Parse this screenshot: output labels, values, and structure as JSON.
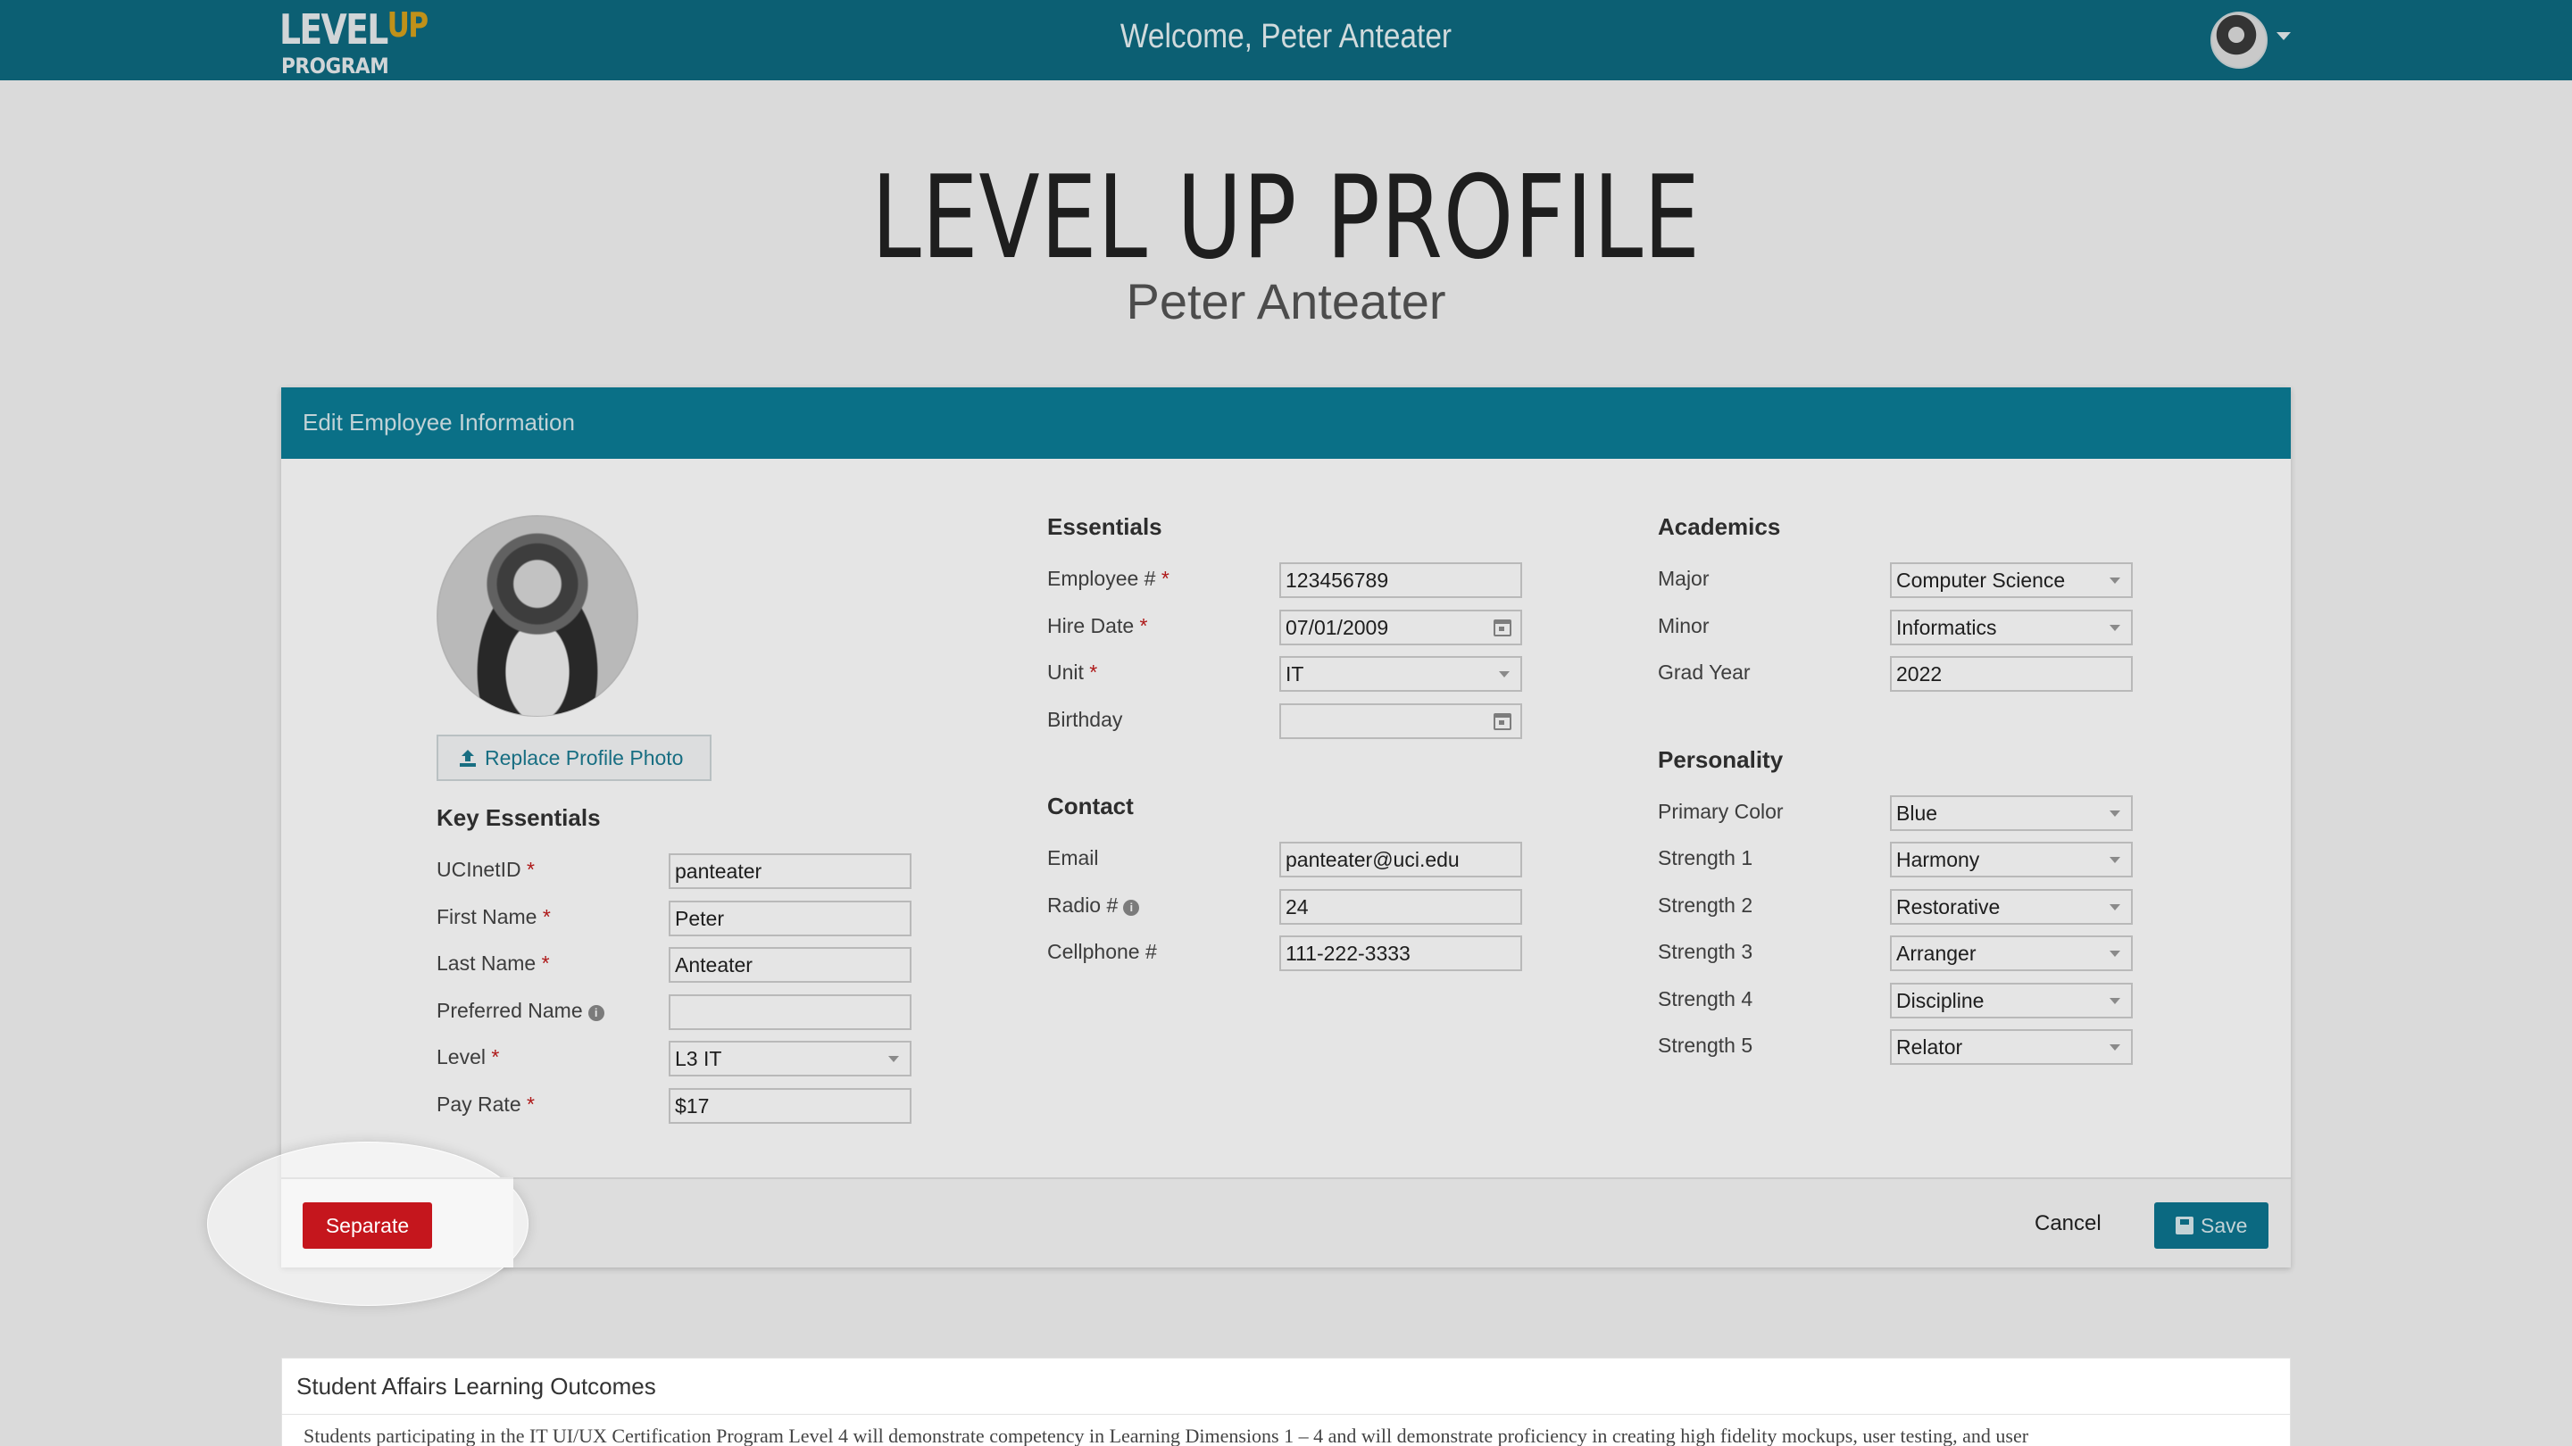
{
  "nav": {
    "logo_top": "LEVEL",
    "logo_up": "UP",
    "logo_bottom": "PROGRAM",
    "welcome": "Welcome, Peter Anteater"
  },
  "page": {
    "title": "LEVEL UP PROFILE",
    "subtitle": "Peter Anteater"
  },
  "panel": {
    "header": "Edit Employee Information",
    "replace_photo": "Replace Profile Photo",
    "key_essentials": {
      "heading": "Key Essentials",
      "fields": [
        {
          "label": "UCInetID",
          "value": "panteater"
        },
        {
          "label": "First Name",
          "value": "Peter"
        },
        {
          "label": "Last Name",
          "value": "Anteater"
        },
        {
          "label": "Preferred Name",
          "value": ""
        },
        {
          "label": "Level",
          "value": "L3 IT"
        },
        {
          "label": "Pay Rate",
          "value": "$17"
        }
      ]
    },
    "essentials": {
      "heading": "Essentials",
      "fields": [
        {
          "label": "Employee #",
          "value": "123456789"
        },
        {
          "label": "Hire Date",
          "value": "07/01/2009"
        },
        {
          "label": "Unit",
          "value": "IT"
        },
        {
          "label": "Birthday",
          "value": ""
        }
      ]
    },
    "contact": {
      "heading": "Contact",
      "fields": [
        {
          "label": "Email",
          "value": "panteater@uci.edu"
        },
        {
          "label": "Radio #",
          "value": "24"
        },
        {
          "label": "Cellphone #",
          "value": "111-222-3333"
        }
      ]
    },
    "academics": {
      "heading": "Academics",
      "fields": [
        {
          "label": "Major",
          "value": "Computer Science"
        },
        {
          "label": "Minor",
          "value": "Informatics"
        },
        {
          "label": "Grad Year",
          "value": "2022"
        }
      ]
    },
    "personality": {
      "heading": "Personality",
      "fields": [
        {
          "label": "Primary Color",
          "value": "Blue"
        },
        {
          "label": "Strength 1",
          "value": "Harmony"
        },
        {
          "label": "Strength 2",
          "value": "Restorative"
        },
        {
          "label": "Strength 3",
          "value": "Arranger"
        },
        {
          "label": "Strength 4",
          "value": "Discipline"
        },
        {
          "label": "Strength 5",
          "value": "Relator"
        }
      ]
    },
    "required_mark": "*",
    "info_mark": "i",
    "footer": {
      "separate": "Separate",
      "cancel": "Cancel",
      "save": "Save"
    }
  },
  "outcomes": {
    "title": "Student Affairs Learning Outcomes",
    "text": "Students participating in the IT UI/UX Certification Program Level 4 will demonstrate competency in Learning Dimensions 1 – 4 and will demonstrate proficiency in creating high fidelity mockups, user testing, and user"
  },
  "colors": {
    "brand_teal": "#0c7d97",
    "nav_teal": "#0e6a80",
    "danger_red": "#c5161d",
    "required_red": "#c21b1b"
  },
  "icons": [
    "user-avatar-icon",
    "caret-down-icon",
    "upload-icon",
    "calendar-icon",
    "info-icon",
    "save-disk-icon"
  ]
}
